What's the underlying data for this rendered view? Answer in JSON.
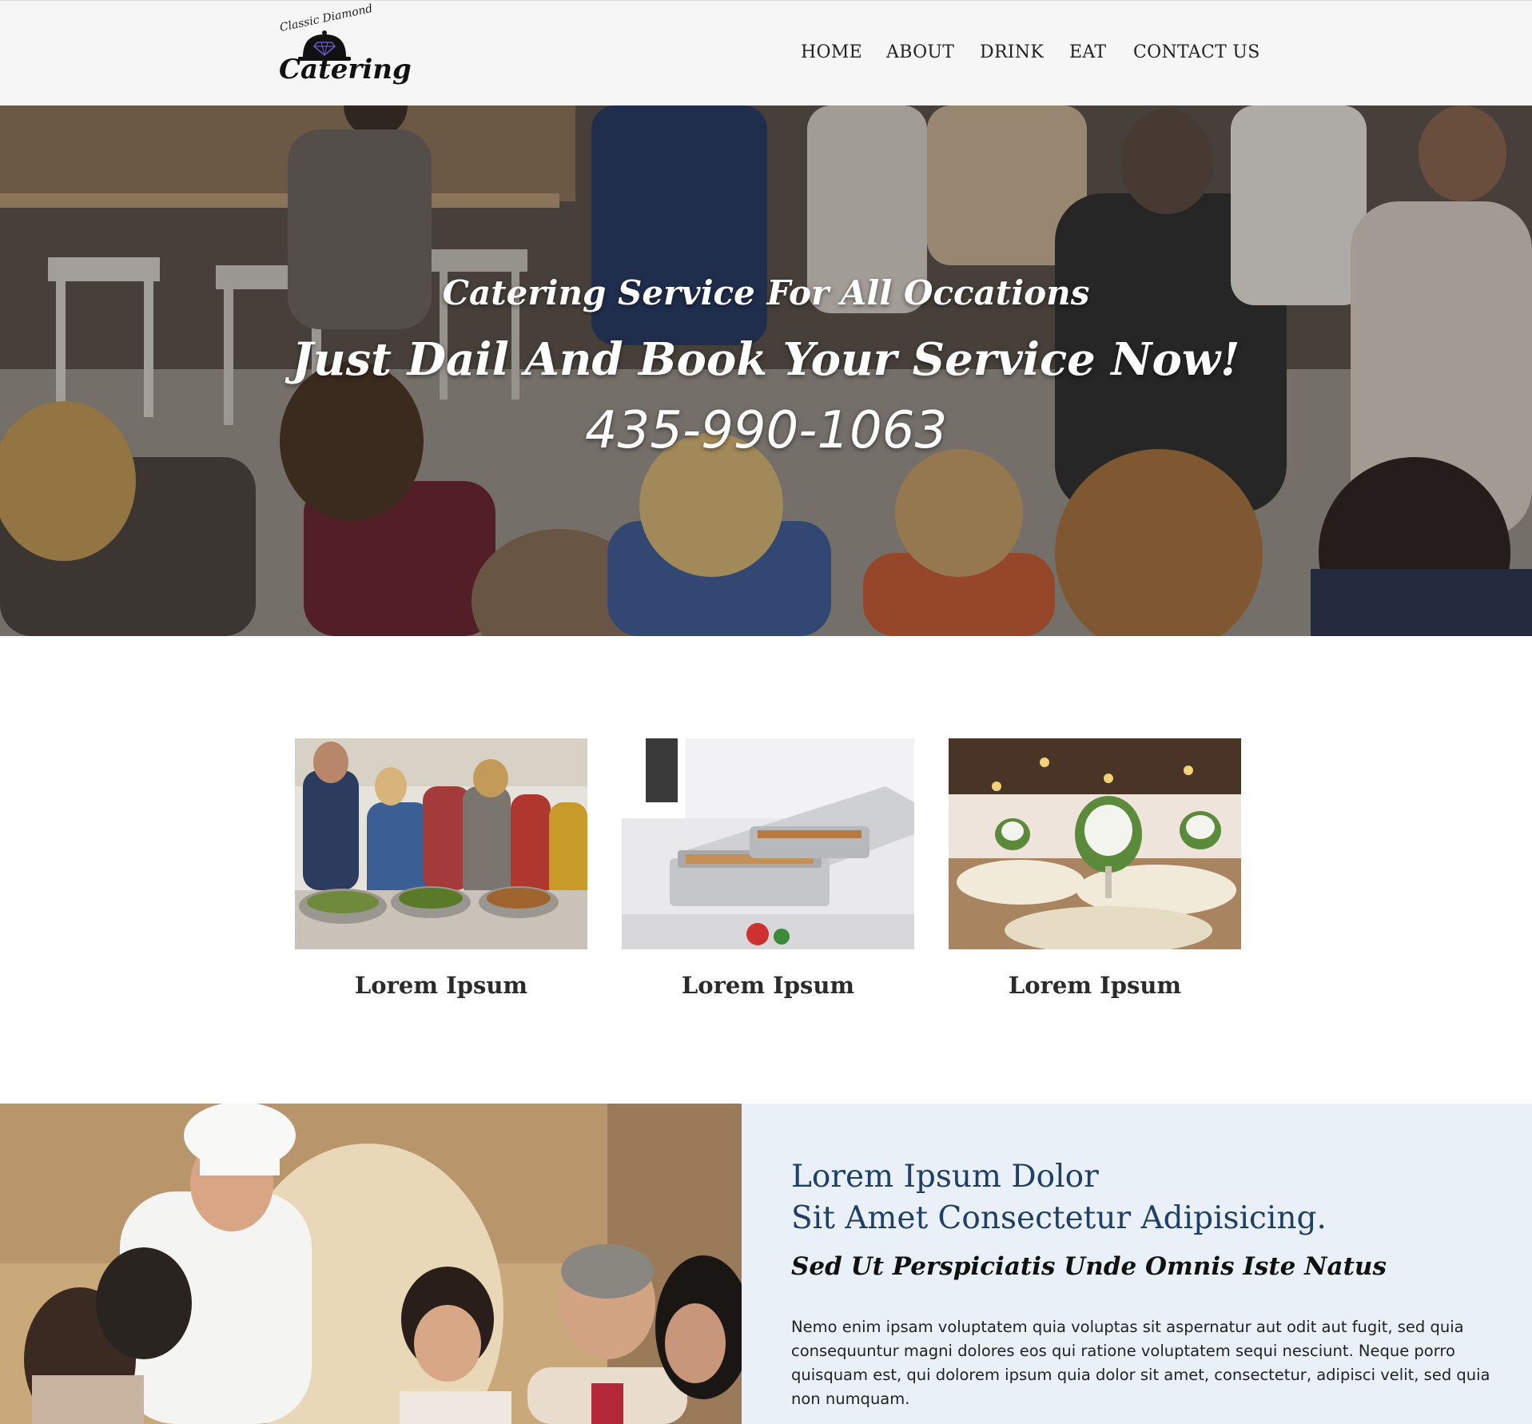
{
  "header": {
    "logo": {
      "top_text": "Classic Diamond",
      "bottom_text": "Catering"
    },
    "nav": [
      {
        "label": "HOME"
      },
      {
        "label": "ABOUT"
      },
      {
        "label": "DRINK"
      },
      {
        "label": "EAT"
      },
      {
        "label": "CONTACT US"
      }
    ]
  },
  "hero": {
    "line1": "Catering Service For All Occations",
    "line2": "Just Dail And Book Your Service Now!",
    "phone": "435-990-1063"
  },
  "cards": [
    {
      "title": "Lorem Ipsum"
    },
    {
      "title": "Lorem Ipsum"
    },
    {
      "title": "Lorem Ipsum"
    }
  ],
  "about": {
    "heading_line1": "Lorem Ipsum Dolor",
    "heading_line2": "Sit Amet Consectetur Adipisicing.",
    "subheading": "Sed Ut Perspiciatis Unde Omnis Iste Natus",
    "body": "Nemo enim ipsam voluptatem quia voluptas sit aspernatur aut odit aut fugit, sed quia consequuntur magni dolores eos qui ratione voluptatem sequi nesciunt. Neque porro quisquam est, qui dolorem ipsum quia dolor sit amet, consectetur, adipisci velit, sed quia non numquam."
  },
  "colors": {
    "header_bg": "#f6f6f6",
    "heading_blue": "#1f3f66",
    "panel_bg": "#e9f0f7"
  }
}
